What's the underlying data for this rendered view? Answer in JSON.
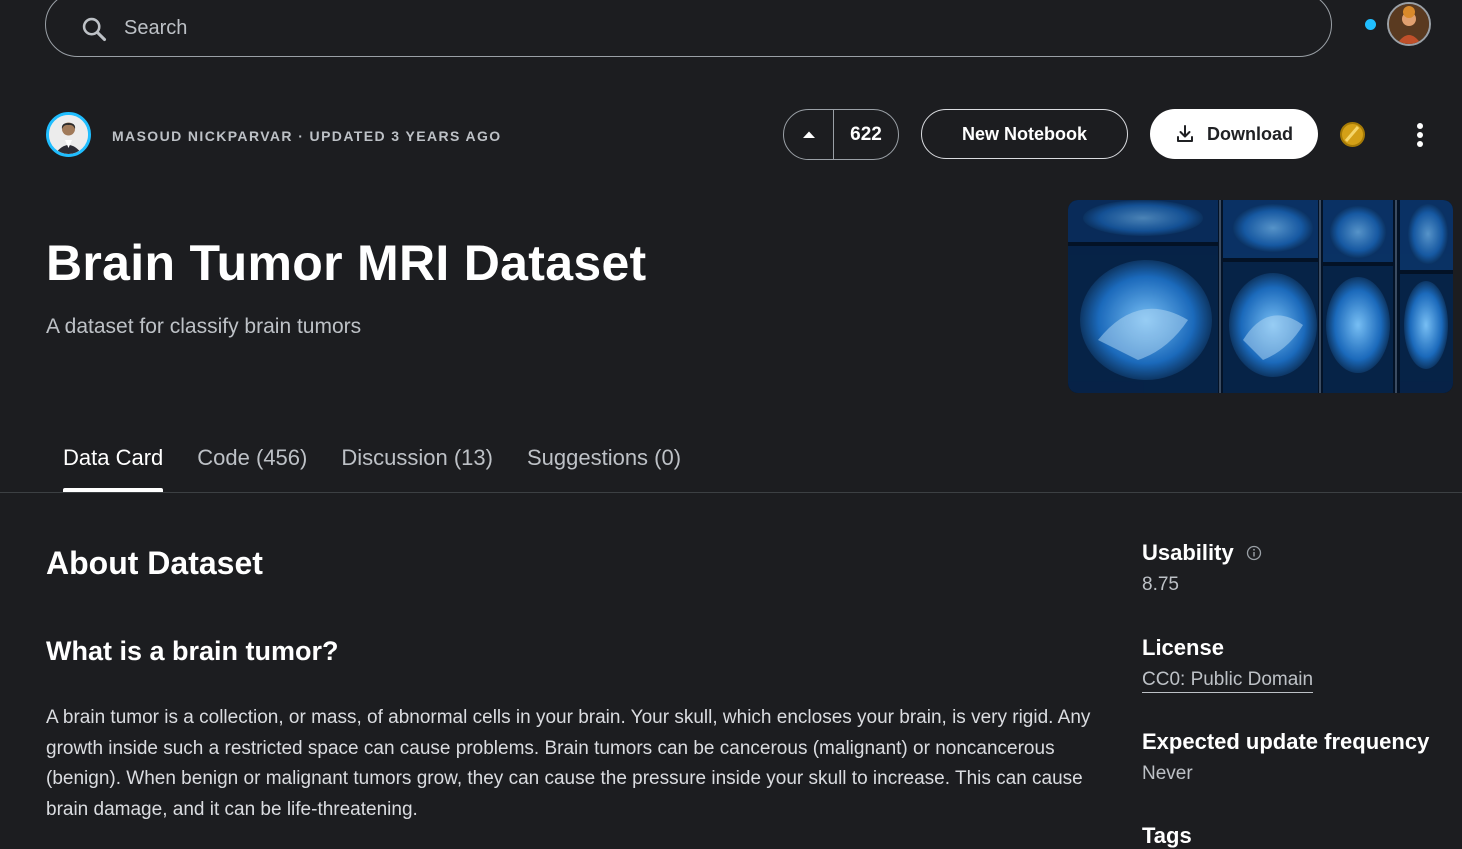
{
  "search": {
    "placeholder": "Search"
  },
  "author": {
    "line": "MASOUD NICKPARVAR · UPDATED 3 YEARS AGO"
  },
  "actions": {
    "vote_count": "622",
    "new_notebook_label": "New Notebook",
    "download_label": "Download"
  },
  "dataset": {
    "title": "Brain Tumor MRI Dataset",
    "subtitle": "A dataset for classify brain tumors"
  },
  "tabs": [
    {
      "label": "Data Card",
      "active": true
    },
    {
      "label": "Code (456)",
      "active": false
    },
    {
      "label": "Discussion (13)",
      "active": false
    },
    {
      "label": "Suggestions (0)",
      "active": false
    }
  ],
  "content": {
    "about_heading": "About Dataset",
    "question_heading": "What is a brain tumor?",
    "paragraph": "A brain tumor is a collection, or mass, of abnormal cells in your brain. Your skull, which encloses your brain, is very rigid. Any growth inside such a restricted space can cause problems. Brain tumors can be cancerous (malignant) or noncancerous (benign). When benign or malignant tumors grow, they can cause the pressure inside your skull to increase. This can cause brain damage, and it can be life-threatening."
  },
  "sidebar": {
    "usability_label": "Usability",
    "usability_value": "8.75",
    "license_label": "License",
    "license_value": "CC0: Public Domain",
    "frequency_label": "Expected update frequency",
    "frequency_value": "Never",
    "tags_label": "Tags"
  },
  "colors": {
    "background": "#1c1d20",
    "accent": "#20beff",
    "text_primary": "#ffffff",
    "text_secondary": "#bdc1c6",
    "medal": "#d4a017"
  },
  "icons": {
    "search": "search-icon",
    "upvote": "caret-up-icon",
    "download": "download-icon",
    "more": "more-vertical-icon",
    "info": "info-icon",
    "medal": "medal-icon"
  }
}
